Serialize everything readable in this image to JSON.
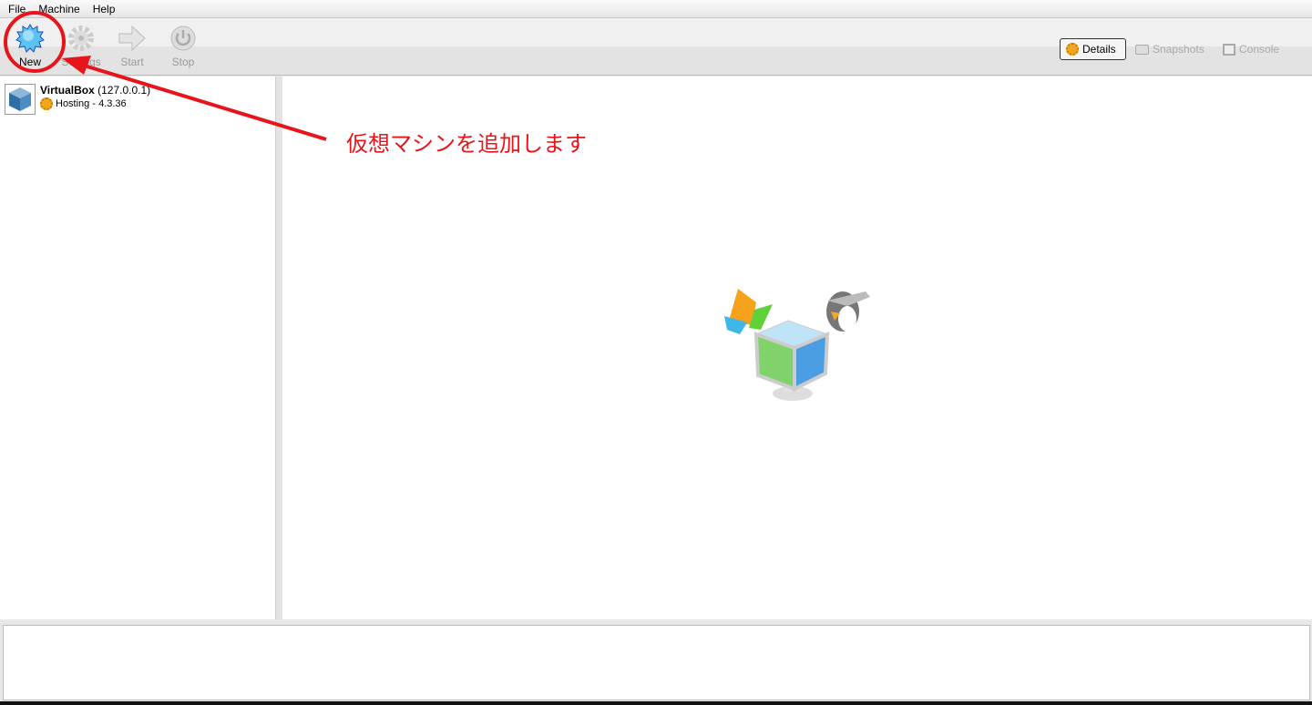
{
  "menu": [
    "File",
    "Machine",
    "Help"
  ],
  "toolbar": {
    "new": "New",
    "settings": "Settings",
    "start": "Start",
    "stop": "Stop"
  },
  "views": {
    "details": "Details",
    "snapshots": "Snapshots",
    "console": "Console"
  },
  "vm": {
    "name": "VirtualBox",
    "address": "(127.0.0.1)",
    "state": "Hosting - 4.3.36"
  },
  "annotation": {
    "text": "仮想マシンを追加します",
    "color": "#e8141c"
  }
}
